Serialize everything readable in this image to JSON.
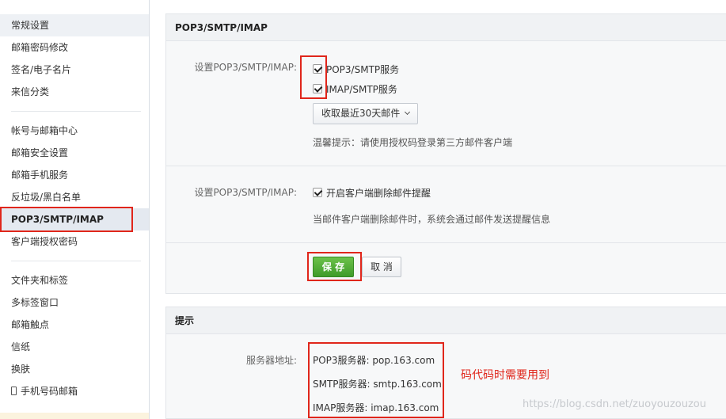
{
  "sidebar": {
    "group1": [
      "常规设置",
      "邮箱密码修改",
      "签名/电子名片",
      "来信分类"
    ],
    "group2": [
      "帐号与邮箱中心",
      "邮箱安全设置",
      "邮箱手机服务",
      "反垃圾/黑白名单",
      "POP3/SMTP/IMAP",
      "客户端授权密码"
    ],
    "group3": [
      "文件夹和标签",
      "多标签窗口",
      "邮箱触点",
      "信纸",
      "换肤",
      "手机号码邮箱"
    ]
  },
  "pop_panel": {
    "title": "POP3/SMTP/IMAP",
    "row1_label": "设置POP3/SMTP/IMAP:",
    "option_pop3_smtp": "POP3/SMTP服务",
    "option_imap_smtp": "IMAP/SMTP服务",
    "receive_select": "收取最近30天邮件",
    "tip": "温馨提示：请使用授权码登录第三方邮件客户端",
    "row2_label": "设置POP3/SMTP/IMAP:",
    "option_delete_alert": "开启客户端删除邮件提醒",
    "delete_note": "当邮件客户端删除邮件时，系统会通过邮件发送提醒信息",
    "save_label": "保 存",
    "cancel_label": "取 消"
  },
  "tips_panel": {
    "title": "提示",
    "server_label": "服务器地址:",
    "pop3_server": "POP3服务器: pop.163.com",
    "smtp_server": "SMTP服务器: smtp.163.com",
    "imap_server": "IMAP服务器: imap.163.com"
  },
  "annotation": "码代码时需要用到",
  "watermark": "https://blog.csdn.net/zuoyouzouzou",
  "colors": {
    "highlight_red": "#e0261b",
    "save_green": "#4caf35",
    "active_item_bg": "#e4e9f0"
  }
}
